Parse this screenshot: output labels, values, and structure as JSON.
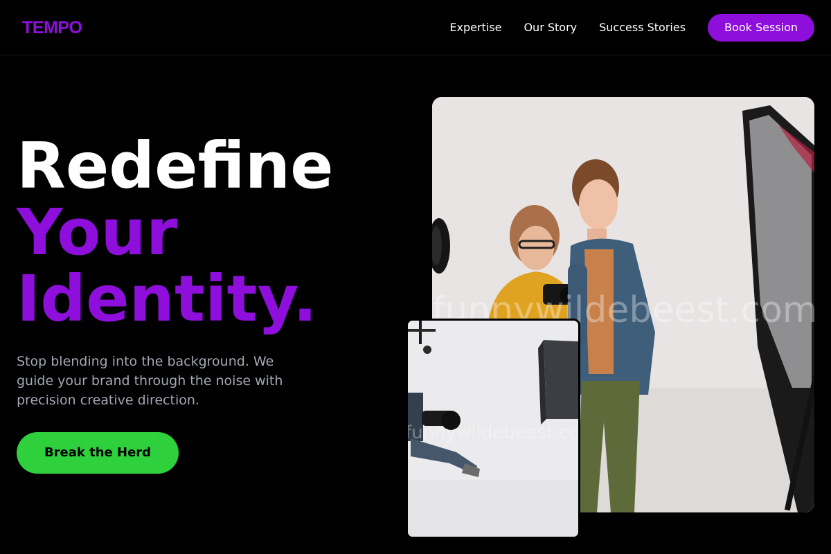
{
  "brand": {
    "name": "TEMPO"
  },
  "colors": {
    "accent": "#8e0fdc",
    "cta_green": "#2ed13c",
    "background": "#000000",
    "muted_text": "#a3a8b4"
  },
  "nav": {
    "links": [
      "Expertise",
      "Our Story",
      "Success Stories"
    ],
    "cta_label": "Book Session"
  },
  "hero": {
    "title_line1": "Redefine",
    "title_line2": "Your",
    "title_line3": "Identity.",
    "subtitle": "Stop blending into the background. We guide your brand through the noise with precision creative direction.",
    "cta_label": "Break the Herd"
  },
  "images": {
    "main_watermark": "funnywildebeest.com",
    "small_watermark": "funnywildebeest.com"
  }
}
